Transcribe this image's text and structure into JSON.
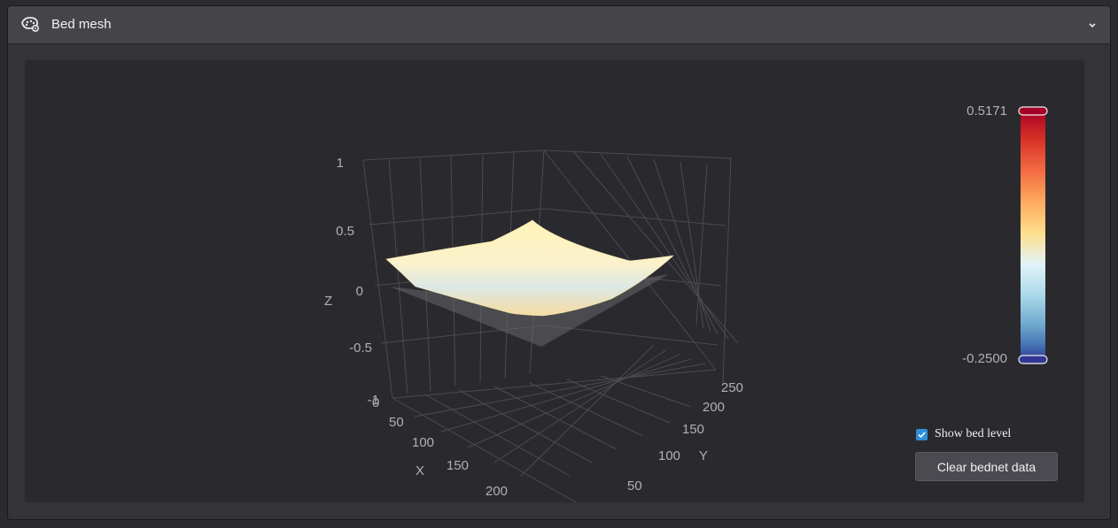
{
  "panel": {
    "title": "Bed mesh",
    "icon": "bed-mesh-icon",
    "collapse_icon": "chevron-down-icon"
  },
  "plot": {
    "z_ticks": [
      "1",
      "0.5",
      "0",
      "-0.5",
      "-1"
    ],
    "z_label": "Z",
    "x_ticks": [
      "0",
      "50",
      "100",
      "150",
      "200"
    ],
    "x_label": "X",
    "y_ticks": [
      "50",
      "100",
      "150",
      "200",
      "250"
    ],
    "y_label": "Y"
  },
  "colorscale": {
    "max": "0.5171",
    "min": "-0.2500",
    "colors": [
      "#a50026",
      "#d73027",
      "#f46d43",
      "#fdae61",
      "#fee090",
      "#e0f3f8",
      "#abd9e9",
      "#74add1",
      "#4575b4",
      "#313695"
    ]
  },
  "controls": {
    "show_bed_level_label": "Show bed level",
    "show_bed_level_checked": true,
    "clear_button_label": "Clear bednet data"
  },
  "colors": {
    "accent": "#2f8fd8",
    "surface": "#fdf3c4"
  }
}
